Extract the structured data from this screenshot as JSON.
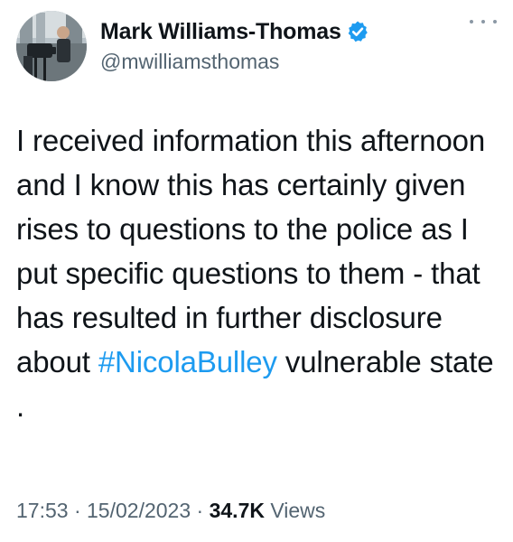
{
  "author": {
    "display_name": "Mark Williams-Thomas",
    "handle": "@mwilliamsthomas",
    "verified": true,
    "avatar_icon": "profile-photo-camera-crew"
  },
  "menu_icon": "more-horizontal-icon",
  "tweet": {
    "text_before_hashtag": "I received information this afternoon and I know this has certainly given rises to questions to the police as I put specific questions to them - that has resulted in further disclosure about ",
    "hashtag": "#NicolaBulley",
    "text_after_hashtag": " vulnerable state ."
  },
  "meta": {
    "time": "17:53",
    "separator": "·",
    "date": "15/02/2023",
    "views_count": "34.7K",
    "views_label": "Views"
  },
  "colors": {
    "text": "#0f1419",
    "secondary": "#536471",
    "accent": "#1d9bf0"
  }
}
